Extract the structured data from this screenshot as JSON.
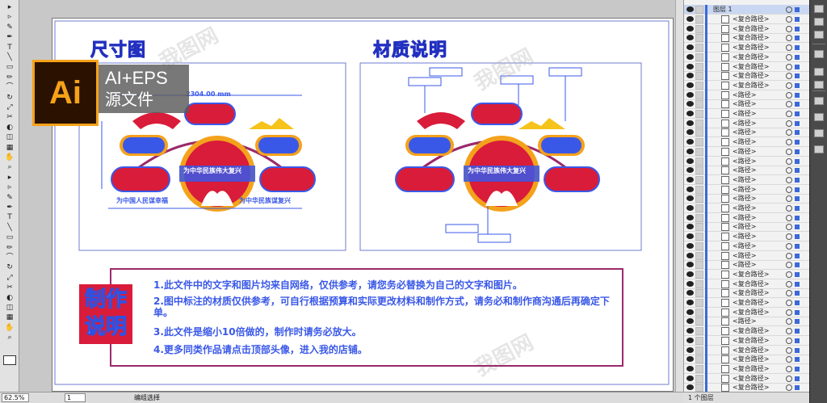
{
  "badge": {
    "logo": "Ai",
    "line1": "AI+EPS",
    "line2": "源文件"
  },
  "artboard": {
    "left_title": "尺寸图",
    "right_title": "材质说明",
    "dimension_top": "2304.00 mm",
    "panel_banner": "为中华民族伟大复兴",
    "panel_caption_left": "为中国人民谋幸福",
    "panel_caption_right": "为中华民族谋复兴"
  },
  "explanation": {
    "stamp": "制作说明",
    "lines": [
      "1.此文件中的文字和图片均来自网络，仅供参考，请您务必替换为自己的文字和图片。",
      "2.图中标注的材质仅供参考，可自行根据预算和实际更改材料和制作方式，请务必和制作商沟通后再确定下单。",
      "3.此文件是缩小10倍做的，制作时请务必放大。",
      "4.更多同类作品请点击顶部头像，进入我的店铺。"
    ]
  },
  "watermark": "我图网",
  "layers": {
    "top_layer": "图层 1",
    "items": [
      "<复合路径>",
      "<复合路径>",
      "<复合路径>",
      "<复合路径>",
      "<复合路径>",
      "<复合路径>",
      "<复合路径>",
      "<复合路径>",
      "<路径>",
      "<路径>",
      "<路径>",
      "<路径>",
      "<路径>",
      "<路径>",
      "<路径>",
      "<路径>",
      "<路径>",
      "<路径>",
      "<路径>",
      "<路径>",
      "<路径>",
      "<路径>",
      "<路径>",
      "<路径>",
      "<路径>",
      "<路径>",
      "<路径>",
      "<复合路径>",
      "<复合路径>",
      "<复合路径>",
      "<复合路径>",
      "<复合路径>",
      "<路径>",
      "<复合路径>",
      "<复合路径>",
      "<复合路径>",
      "<复合路径>",
      "<复合路径>",
      "<复合路径>",
      "<复合路径>"
    ],
    "footer": "1 个图层"
  },
  "statusbar": {
    "zoom": "62.5%",
    "page": "1",
    "tool": "编组选择"
  },
  "colors": {
    "accent": "#3d55e6",
    "red": "#d81c3a",
    "orange": "#f5a21a"
  }
}
